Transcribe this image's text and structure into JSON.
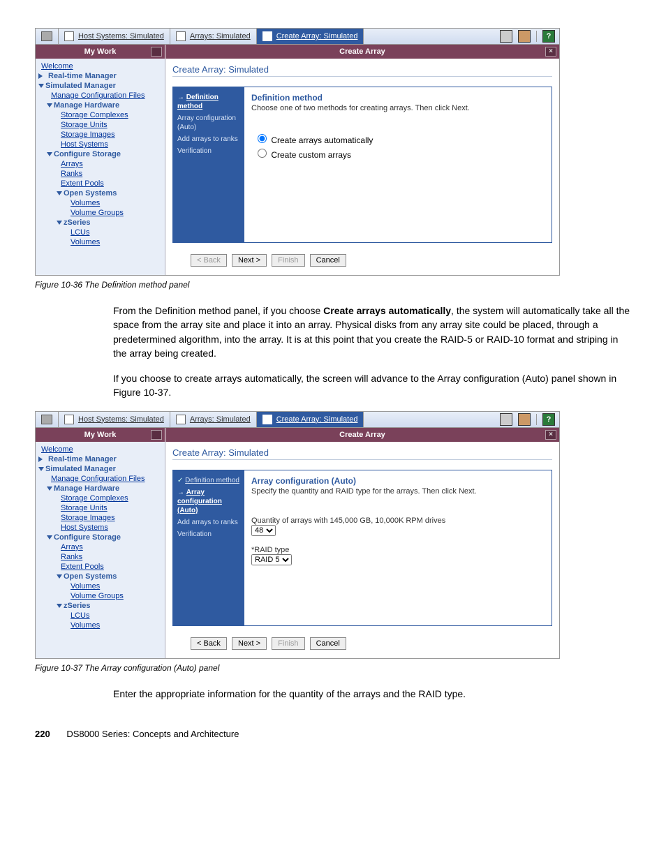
{
  "tabs": {
    "host": "Host Systems: Simulated",
    "arrays": "Arrays: Simulated",
    "create": "Create Array: Simulated"
  },
  "header": {
    "mywork": "My Work",
    "title": "Create Array"
  },
  "nav": {
    "welcome": "Welcome",
    "rtm": "Real-time Manager",
    "sim": "Simulated Manager",
    "mcf": "Manage Configuration Files",
    "mh": "Manage Hardware",
    "sc": "Storage Complexes",
    "su": "Storage Units",
    "si": "Storage Images",
    "hs": "Host Systems",
    "cs": "Configure Storage",
    "arrays": "Arrays",
    "ranks": "Ranks",
    "ep": "Extent Pools",
    "os": "Open Systems",
    "vols": "Volumes",
    "vg": "Volume Groups",
    "zs": "zSeries",
    "lcus": "LCUs",
    "vols2": "Volumes"
  },
  "subtitle": "Create Array: Simulated",
  "steps": {
    "def": "Definition method",
    "auto": "Array configuration (Auto)",
    "add": "Add arrays to ranks",
    "ver": "Verification"
  },
  "panel1": {
    "title": "Definition method",
    "desc": "Choose one of two methods for creating arrays. Then click Next.",
    "opt1": "Create arrays automatically",
    "opt2": "Create custom arrays"
  },
  "panel2": {
    "title": "Array configuration (Auto)",
    "desc": "Specify the quantity and RAID type for the arrays. Then click Next.",
    "qlabel": "Quantity of arrays with 145,000 GB, 10,000K RPM drives",
    "qval": "48",
    "rlabel": "*RAID type",
    "rval": "RAID 5"
  },
  "btns": {
    "back": "< Back",
    "next": "Next >",
    "finish": "Finish",
    "cancel": "Cancel"
  },
  "captions": {
    "f1": "Figure 10-36   The Definition method panel",
    "f2": "Figure 10-37   The Array configuration (Auto) panel"
  },
  "para1a": "From the Definition method panel, if you choose ",
  "para1b": "Create arrays automatically",
  "para1c": ", the system will automatically take all the space from the array site and place it into an array. Physical disks from any array site could be placed, through a predetermined algorithm, into the array. It is at this point that you create the RAID-5 or RAID-10 format and striping in the array being created.",
  "para2": "If you choose to create arrays automatically, the screen will advance to the Array configuration (Auto) panel shown in Figure 10-37.",
  "para3": "Enter the appropriate information for the quantity of the arrays and the RAID type.",
  "footer": {
    "page": "220",
    "title": "DS8000 Series: Concepts and Architecture"
  }
}
